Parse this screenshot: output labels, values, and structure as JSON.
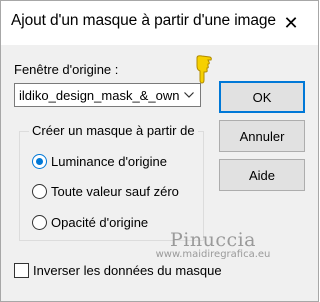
{
  "dialog": {
    "title": "Ajout d'un masque à partir d'une image",
    "close_glyph": "✕"
  },
  "source": {
    "label": "Fenêtre d'origine :",
    "selected_value": "ildiko_design_mask_&_own_"
  },
  "buttons": {
    "ok": "OK",
    "cancel": "Annuler",
    "help": "Aide"
  },
  "mask_group": {
    "title": "Créer un masque à partir de",
    "options": [
      {
        "label": "Luminance d'origine",
        "checked": true
      },
      {
        "label": "Toute valeur sauf zéro",
        "checked": false
      },
      {
        "label": "Opacité d'origine",
        "checked": false
      }
    ]
  },
  "invert": {
    "label": "Inverser les données du masque",
    "checked": false
  },
  "watermark": {
    "name": "Pinuccia",
    "url": "www.maidiregrafica.eu"
  },
  "colors": {
    "accent": "#0078d7",
    "pointer_yellow": "#f6d000"
  },
  "icons": {
    "close": "close-icon",
    "dropdown": "chevron-down-icon",
    "pointer": "pointing-hand-icon"
  }
}
